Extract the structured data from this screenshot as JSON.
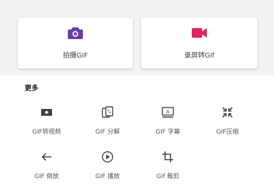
{
  "cards": [
    {
      "label": "拍摄GIF",
      "icon": "camera-icon",
      "color": "#673ab7"
    },
    {
      "label": "录屏转Gif",
      "icon": "videocam-icon",
      "color": "#e91e63"
    }
  ],
  "section": {
    "title": "更多"
  },
  "tools": [
    {
      "label": "GIF转视频",
      "icon": "video-convert-icon"
    },
    {
      "label": "GIF 分解",
      "icon": "split-image-icon"
    },
    {
      "label": "GIF 字幕",
      "icon": "subtitle-icon"
    },
    {
      "label": "GIF压缩",
      "icon": "compress-icon"
    },
    {
      "label": "GIF 倒放",
      "icon": "reverse-arrow-icon"
    },
    {
      "label": "GIF 播放",
      "icon": "play-circle-icon"
    },
    {
      "label": "Gif 裁剪",
      "icon": "crop-icon"
    }
  ]
}
